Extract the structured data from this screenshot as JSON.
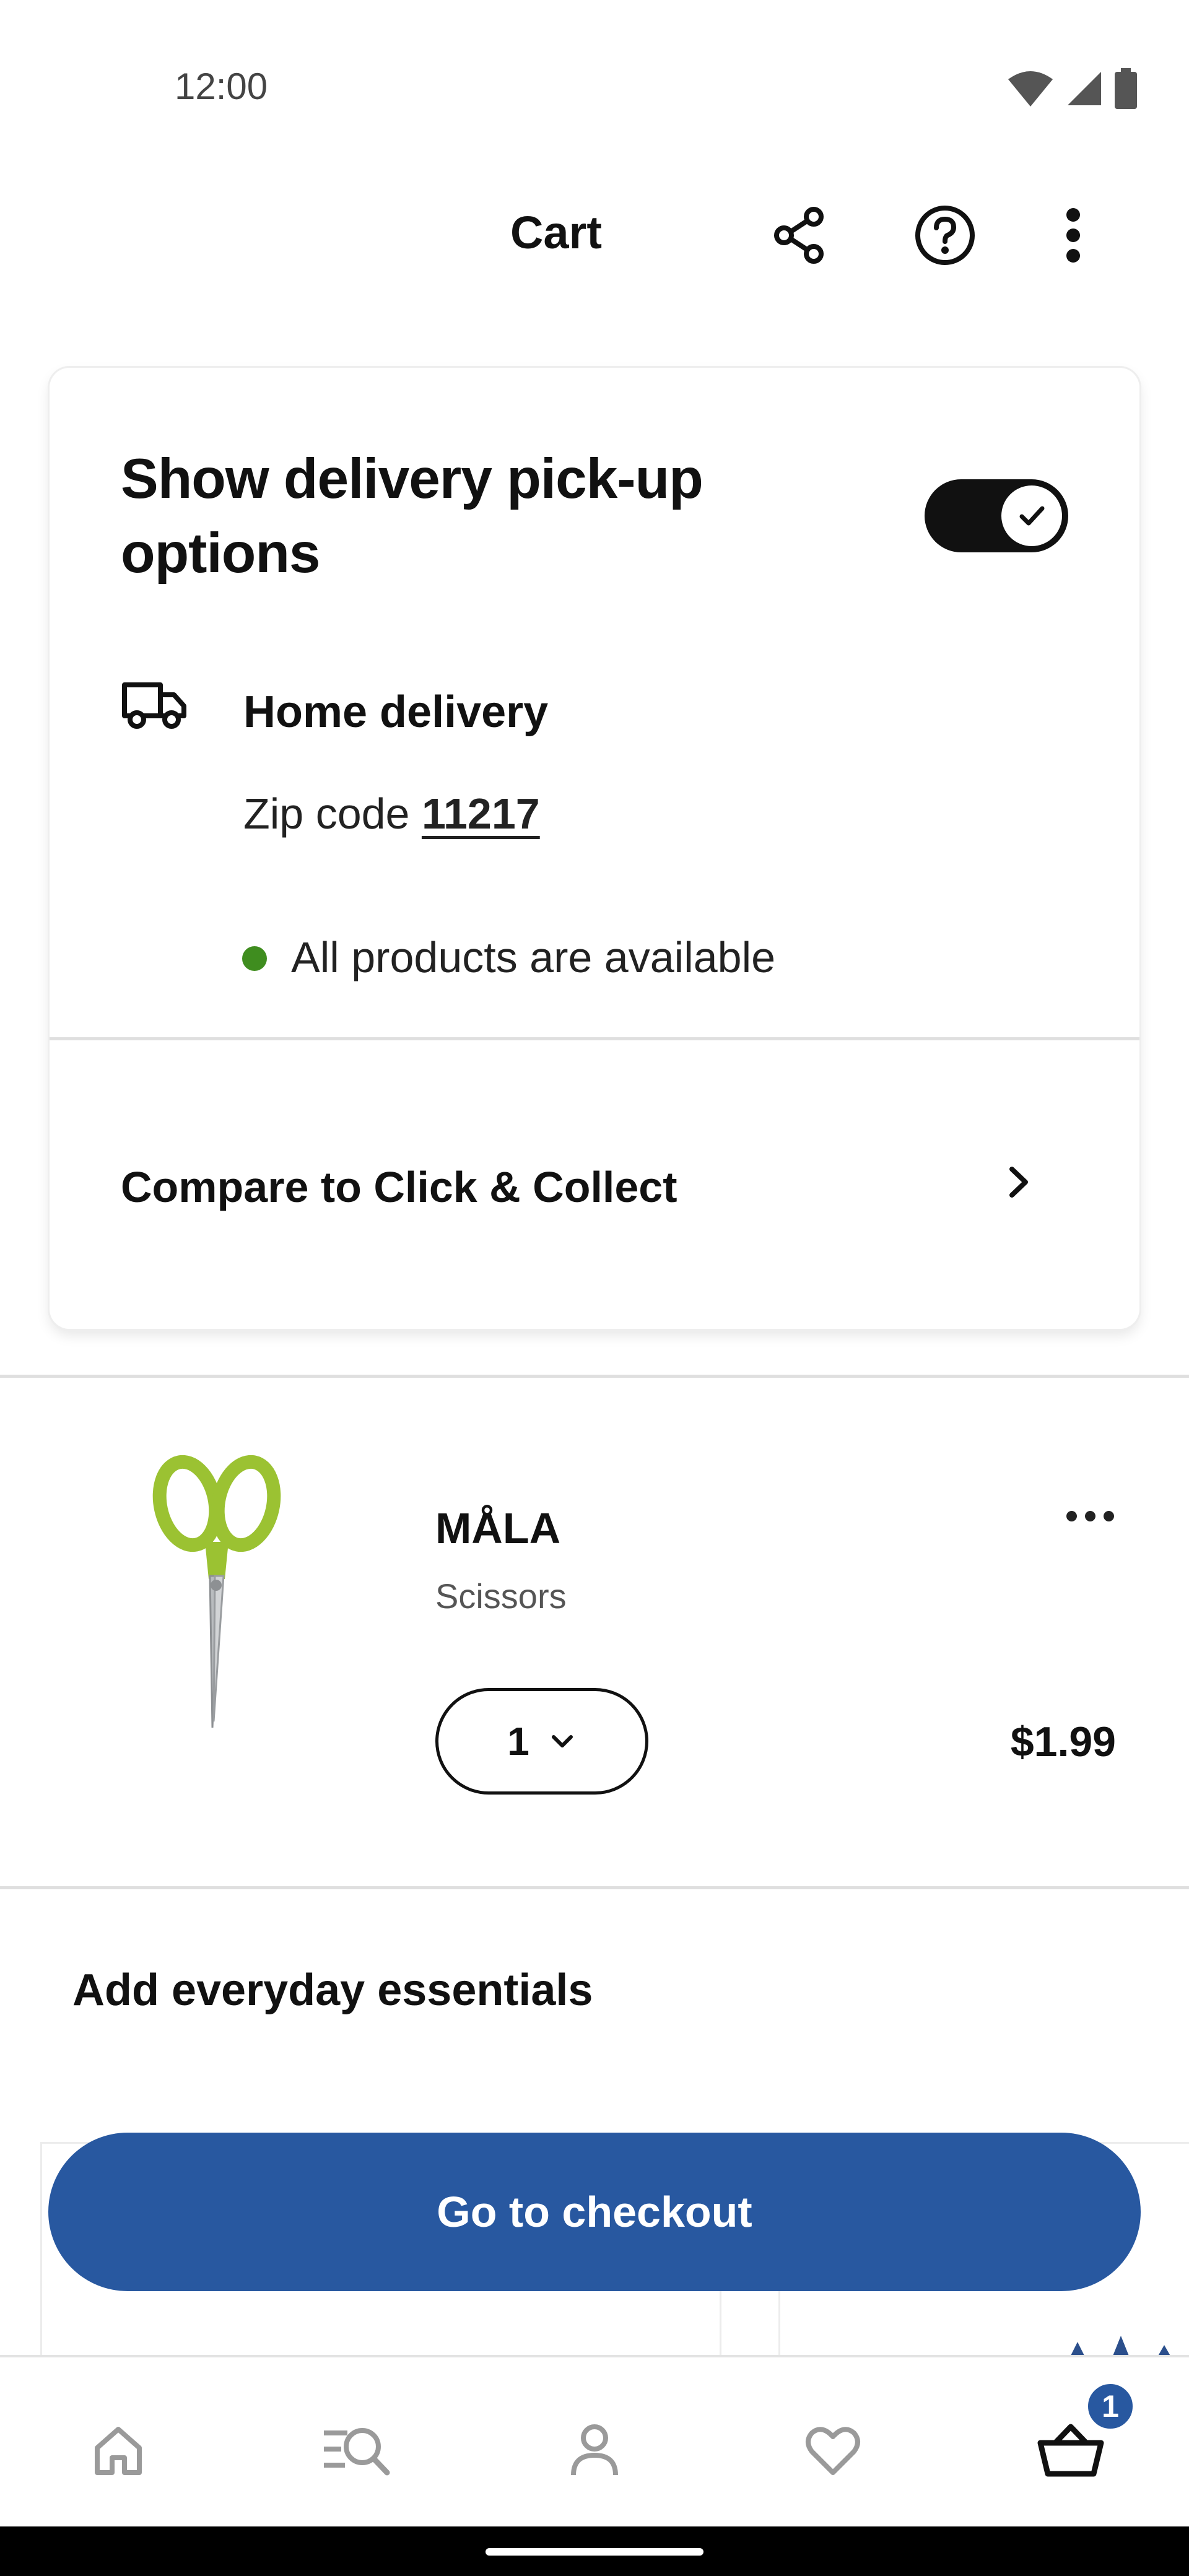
{
  "status_bar": {
    "time": "12:00",
    "icons": [
      "wifi-icon",
      "signal-icon",
      "battery-icon"
    ]
  },
  "app_bar": {
    "title": "Cart",
    "actions": [
      "share-icon",
      "help-icon",
      "more-vertical-icon"
    ]
  },
  "delivery_card": {
    "title": "Show delivery pick-up options",
    "toggle_on": true,
    "method_label": "Home delivery",
    "zip_prefix": "Zip code",
    "zip_code": "11217",
    "availability": "All products are available",
    "availability_color": "#3f8d1f",
    "compare_label": "Compare to Click & Collect"
  },
  "cart_items": [
    {
      "name": "MÅLA",
      "description": "Scissors",
      "quantity": "1",
      "price": "$1.99",
      "image": "scissors-image"
    }
  ],
  "essentials": {
    "heading": "Add everyday essentials"
  },
  "checkout": {
    "label": "Go to checkout",
    "color": "#2858a0"
  },
  "bottom_nav": {
    "items": [
      "home-icon",
      "search-icon",
      "account-icon",
      "favorites-icon",
      "cart-icon"
    ],
    "active": "cart-icon",
    "cart_badge": "1"
  }
}
